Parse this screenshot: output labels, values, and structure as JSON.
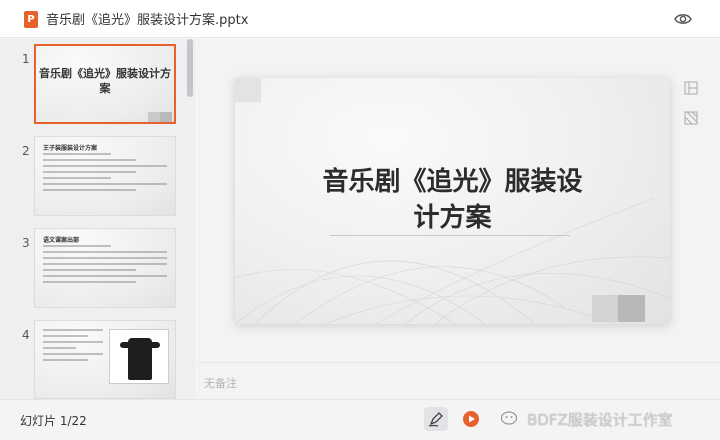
{
  "window": {
    "file_icon_letter": "P",
    "file_name": "音乐剧《追光》服装设计方案.pptx",
    "brand_color": "#e8612c",
    "preview_icon": "eye-icon"
  },
  "sidebar": {
    "thumbnails": [
      {
        "number": "1",
        "title": "音乐剧《追光》服装设计方案",
        "selected": true
      },
      {
        "number": "2",
        "heading": "王子装服装设计方案",
        "selected": false
      },
      {
        "number": "3",
        "heading": "语文课案出部",
        "selected": false
      },
      {
        "number": "4",
        "selected": false
      }
    ]
  },
  "slide": {
    "title": "音乐剧《追光》服装设计方案"
  },
  "notes": {
    "placeholder": "无备注"
  },
  "footer": {
    "slide_counter": "幻灯片 1/22",
    "pen_icon": "pen-icon",
    "play_icon": "play-icon",
    "watermark": "BDFZ服装设计工作室"
  }
}
